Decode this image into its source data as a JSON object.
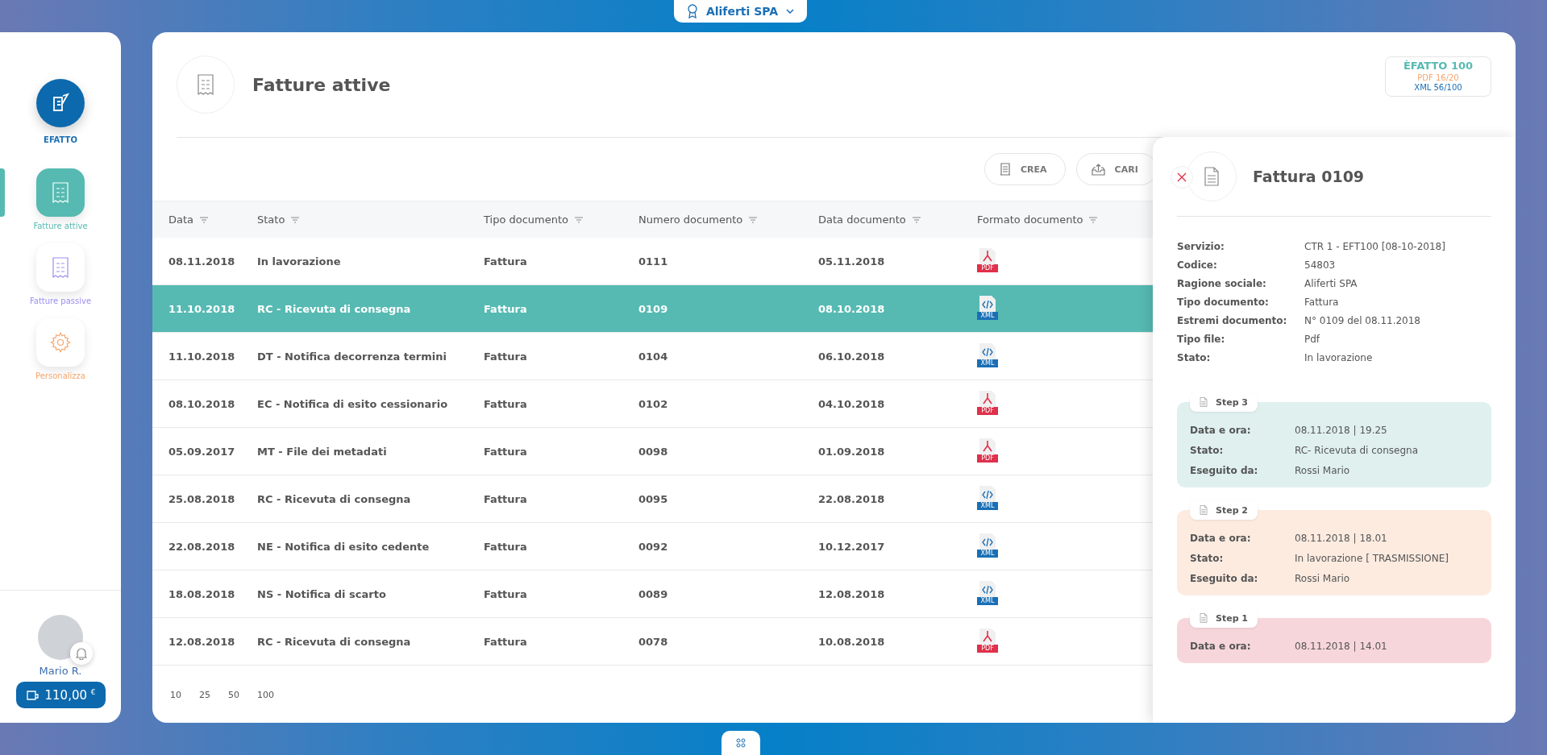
{
  "company_switcher": {
    "label": "Aliferti SPA"
  },
  "sidebar": {
    "logo_label": "EFATTO",
    "items": [
      {
        "label": "Fatture attive",
        "selected": true,
        "kind": "receipt",
        "color": "#56bab2"
      },
      {
        "label": "Fatture passive",
        "selected": false,
        "kind": "receipt",
        "color": "#9b8ff0"
      },
      {
        "label": "Personalizza",
        "selected": false,
        "kind": "gear",
        "color": "#f5a46c"
      }
    ],
    "user": {
      "name": "Mario R.",
      "balance": "110,00 $^{€}$"
    }
  },
  "page": {
    "title": "Fatture attive",
    "counters": [
      {
        "text": "ÈFATTO 100",
        "color": "#56bab2"
      },
      {
        "text": "PDF 16/20",
        "color": "#f5a46c"
      },
      {
        "text": "XML 56/100",
        "color": "#1a6fb5"
      }
    ],
    "actions": [
      {
        "label": "CREA",
        "kind": "create"
      },
      {
        "label": "CARI",
        "kind": "upload"
      }
    ]
  },
  "table": {
    "columns": [
      "Data",
      "Stato",
      "Tipo documento",
      "Numero documento",
      "Data documento",
      "Formato documento"
    ],
    "rows": [
      {
        "date": "08.11.2018",
        "status": "In lavorazione",
        "type": "Fattura",
        "number": "0111",
        "doc_date": "05.11.2018",
        "format": "PDF",
        "kind": "pdf",
        "selected": false
      },
      {
        "date": "11.10.2018",
        "status": "RC - Ricevuta di consegna",
        "type": "Fattura",
        "number": "0109",
        "doc_date": "08.10.2018",
        "format": "XML",
        "kind": "xml",
        "selected": true
      },
      {
        "date": "11.10.2018",
        "status": "DT - Notifica decorrenza termini",
        "type": "Fattura",
        "number": "0104",
        "doc_date": "06.10.2018",
        "format": "XML",
        "kind": "xml",
        "selected": false
      },
      {
        "date": "08.10.2018",
        "status": "EC - Notifica di esito cessionario",
        "type": "Fattura",
        "number": "0102",
        "doc_date": "04.10.2018",
        "format": "PDF",
        "kind": "pdf",
        "selected": false
      },
      {
        "date": "05.09.2017",
        "status": "MT - File dei metadati",
        "type": "Fattura",
        "number": "0098",
        "doc_date": "01.09.2018",
        "format": "PDF",
        "kind": "pdf",
        "selected": false
      },
      {
        "date": "25.08.2018",
        "status": "RC - Ricevuta di consegna",
        "type": "Fattura",
        "number": "0095",
        "doc_date": "22.08.2018",
        "format": "XML",
        "kind": "xml",
        "selected": false
      },
      {
        "date": "22.08.2018",
        "status": "NE - Notifica di esito cedente",
        "type": "Fattura",
        "number": "0092",
        "doc_date": "10.12.2017",
        "format": "XML",
        "kind": "xml",
        "selected": false
      },
      {
        "date": "18.08.2018",
        "status": "NS - Notifica di scarto",
        "type": "Fattura",
        "number": "0089",
        "doc_date": "12.08.2018",
        "format": "XML",
        "kind": "xml",
        "selected": false
      },
      {
        "date": "12.08.2018",
        "status": "RC - Ricevuta di consegna",
        "type": "Fattura",
        "number": "0078",
        "doc_date": "10.08.2018",
        "format": "PDF",
        "kind": "pdf",
        "selected": false
      }
    ],
    "page_sizes": [
      "10",
      "25",
      "50",
      "100"
    ]
  },
  "detail_panel": {
    "title": "Fattura 0109",
    "fields": [
      {
        "label": "Servizio:",
        "value": "CTR 1 - EFT100 [08-10-2018]"
      },
      {
        "label": "Codice:",
        "value": "54803"
      },
      {
        "label": "Ragione sociale:",
        "value": "Aliferti SPA"
      },
      {
        "label": "Tipo documento:",
        "value": "Fattura"
      },
      {
        "label": "Estremi documento:",
        "value": "N° 0109 del 08.11.2018"
      },
      {
        "label": "Tipo file:",
        "value": "Pdf"
      },
      {
        "label": "Stato:",
        "value": "In lavorazione"
      }
    ],
    "steps": [
      {
        "label": "Step 3",
        "color": "#dff0ef",
        "fields": [
          {
            "label": "Data e ora:",
            "value": "08.11.2018 | 19.25"
          },
          {
            "label": "Stato:",
            "value": "RC- Ricevuta di consegna"
          },
          {
            "label": "Eseguito da:",
            "value": "Rossi Mario"
          }
        ]
      },
      {
        "label": "Step 2",
        "color": "#fdebe0",
        "fields": [
          {
            "label": "Data e ora:",
            "value": "08.11.2018 | 18.01"
          },
          {
            "label": "Stato:",
            "value": "In lavorazione [ TRASMISSIONE]"
          },
          {
            "label": "Eseguito da:",
            "value": "Rossi Mario"
          }
        ]
      },
      {
        "label": "Step 1",
        "color": "#f7d6db",
        "fields": [
          {
            "label": "Data e ora:",
            "value": "08.11.2018 | 14.01"
          }
        ]
      }
    ]
  }
}
